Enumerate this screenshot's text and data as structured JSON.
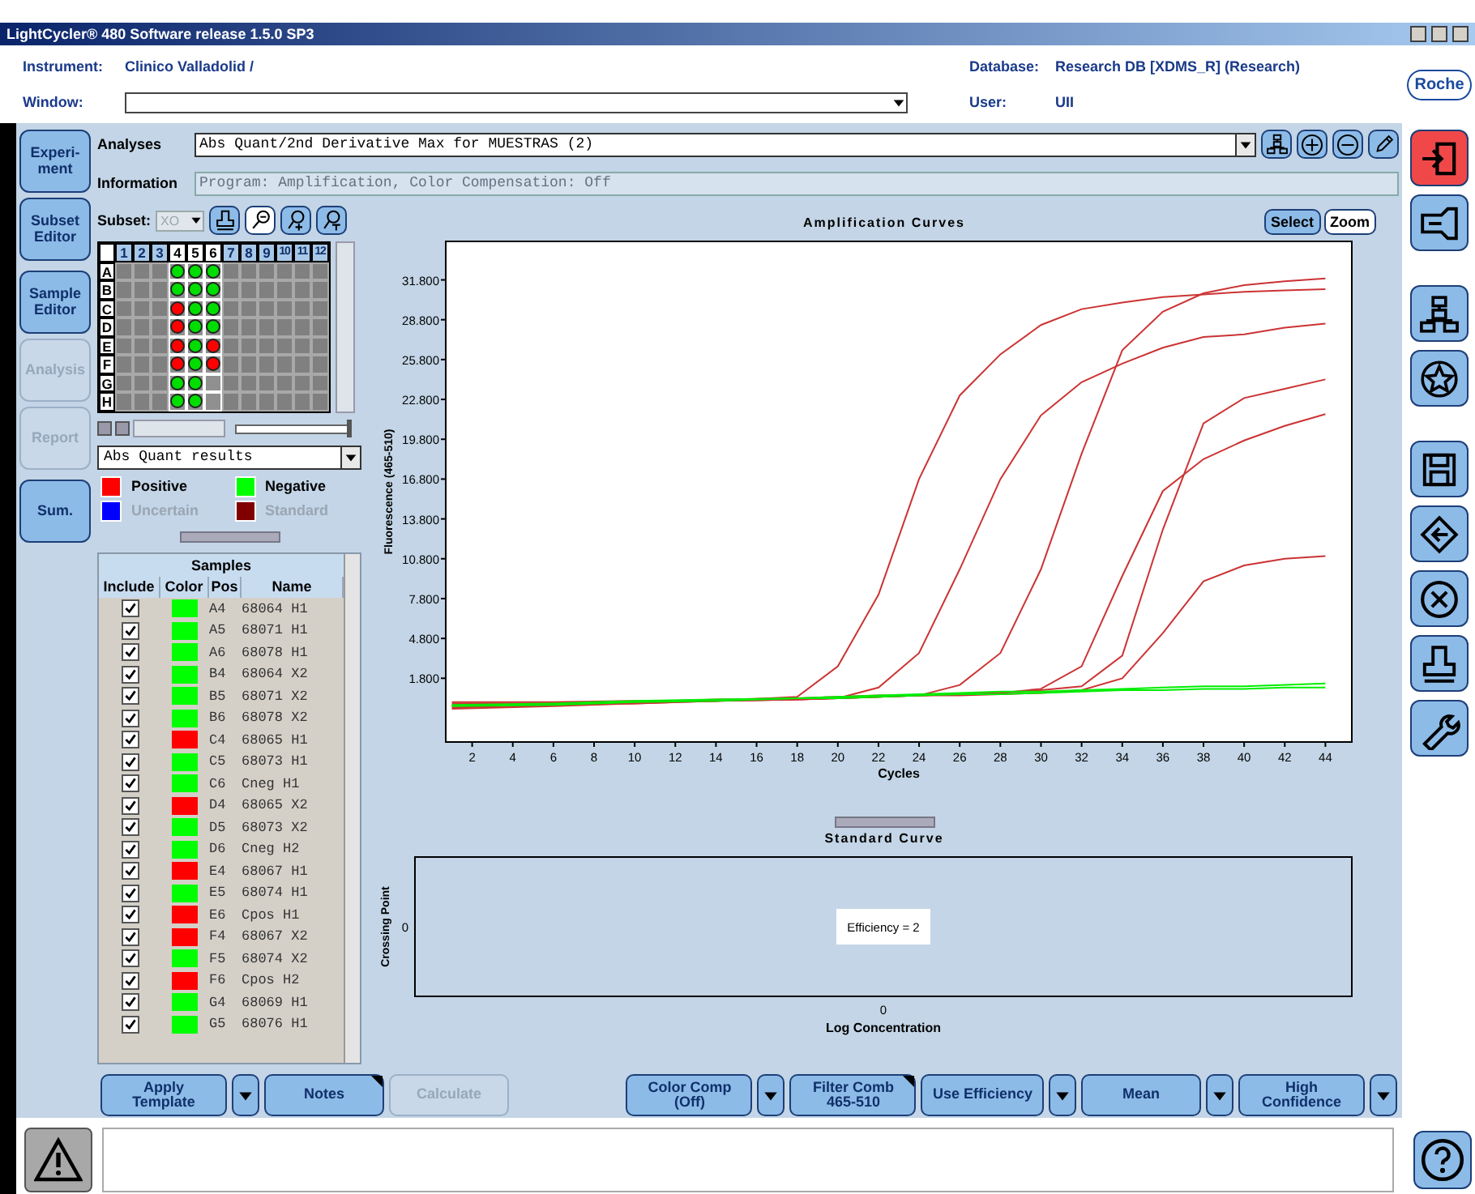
{
  "window": {
    "title": "LightCycler® 480 Software release 1.5.0 SP3"
  },
  "header": {
    "instrument_label": "Instrument:",
    "instrument": "Clinico Valladolid /",
    "window_label": "Window:",
    "database_label": "Database:",
    "database": "Research DB [XDMS_R] (Research)",
    "user_label": "User:",
    "user": "UII",
    "logo": "Roche"
  },
  "nav": [
    {
      "label": "Experi-ment",
      "disabled": false
    },
    {
      "label": "Subset Editor",
      "disabled": false
    },
    {
      "label": "Sample Editor",
      "disabled": false
    },
    {
      "label": "Analysis",
      "disabled": true
    },
    {
      "label": "Report",
      "disabled": true
    },
    {
      "label": "Sum.",
      "disabled": false
    }
  ],
  "analyses": {
    "label": "Analyses",
    "value": "Abs Quant/2nd Derivative Max for MUESTRAS (2)"
  },
  "information": {
    "label": "Information",
    "value": "Program: Amplification, Color Compensation: Off"
  },
  "subset": {
    "label": "Subset:",
    "value": "XO"
  },
  "plate": {
    "columns": [
      {
        "label": "1",
        "selected": false
      },
      {
        "label": "2",
        "selected": false
      },
      {
        "label": "3",
        "selected": false
      },
      {
        "label": "4",
        "selected": true
      },
      {
        "label": "5",
        "selected": true
      },
      {
        "label": "6",
        "selected": true
      },
      {
        "label": "7",
        "selected": false
      },
      {
        "label": "8",
        "selected": false
      },
      {
        "label": "9",
        "selected": false
      },
      {
        "label": "10",
        "selected": false
      },
      {
        "label": "11",
        "selected": false
      },
      {
        "label": "12",
        "selected": false
      }
    ],
    "rows": [
      {
        "label": "A",
        "wells": [
          {
            "filled": false
          },
          {
            "filled": false
          },
          {
            "filled": false
          },
          {
            "filled": true,
            "color": "#00dd00"
          },
          {
            "filled": true,
            "color": "#00dd00"
          },
          {
            "filled": true,
            "color": "#00dd00"
          },
          {
            "filled": false
          },
          {
            "filled": false
          },
          {
            "filled": false
          },
          {
            "filled": false
          },
          {
            "filled": false
          },
          {
            "filled": false
          }
        ]
      },
      {
        "label": "B",
        "wells": [
          {
            "filled": false
          },
          {
            "filled": false
          },
          {
            "filled": false
          },
          {
            "filled": true,
            "color": "#00dd00"
          },
          {
            "filled": true,
            "color": "#00dd00"
          },
          {
            "filled": true,
            "color": "#00dd00"
          },
          {
            "filled": false
          },
          {
            "filled": false
          },
          {
            "filled": false
          },
          {
            "filled": false
          },
          {
            "filled": false
          },
          {
            "filled": false
          }
        ]
      },
      {
        "label": "C",
        "wells": [
          {
            "filled": false
          },
          {
            "filled": false
          },
          {
            "filled": false
          },
          {
            "filled": true,
            "color": "#ff0000"
          },
          {
            "filled": true,
            "color": "#00dd00"
          },
          {
            "filled": true,
            "color": "#00dd00"
          },
          {
            "filled": false
          },
          {
            "filled": false
          },
          {
            "filled": false
          },
          {
            "filled": false
          },
          {
            "filled": false
          },
          {
            "filled": false
          }
        ]
      },
      {
        "label": "D",
        "wells": [
          {
            "filled": false
          },
          {
            "filled": false
          },
          {
            "filled": false
          },
          {
            "filled": true,
            "color": "#ff0000"
          },
          {
            "filled": true,
            "color": "#00dd00"
          },
          {
            "filled": true,
            "color": "#00dd00"
          },
          {
            "filled": false
          },
          {
            "filled": false
          },
          {
            "filled": false
          },
          {
            "filled": false
          },
          {
            "filled": false
          },
          {
            "filled": false
          }
        ]
      },
      {
        "label": "E",
        "wells": [
          {
            "filled": false
          },
          {
            "filled": false
          },
          {
            "filled": false
          },
          {
            "filled": true,
            "color": "#ff0000"
          },
          {
            "filled": true,
            "color": "#00dd00"
          },
          {
            "filled": true,
            "color": "#ff0000"
          },
          {
            "filled": false
          },
          {
            "filled": false
          },
          {
            "filled": false
          },
          {
            "filled": false
          },
          {
            "filled": false
          },
          {
            "filled": false
          }
        ]
      },
      {
        "label": "F",
        "wells": [
          {
            "filled": false
          },
          {
            "filled": false
          },
          {
            "filled": false
          },
          {
            "filled": true,
            "color": "#ff0000"
          },
          {
            "filled": true,
            "color": "#00dd00"
          },
          {
            "filled": true,
            "color": "#ff0000"
          },
          {
            "filled": false
          },
          {
            "filled": false
          },
          {
            "filled": false
          },
          {
            "filled": false
          },
          {
            "filled": false
          },
          {
            "filled": false
          }
        ]
      },
      {
        "label": "G",
        "wells": [
          {
            "filled": false
          },
          {
            "filled": false
          },
          {
            "filled": false
          },
          {
            "filled": true,
            "color": "#00dd00"
          },
          {
            "filled": true,
            "color": "#00dd00"
          },
          {
            "filled": false
          },
          {
            "filled": false
          },
          {
            "filled": false
          },
          {
            "filled": false
          },
          {
            "filled": false
          },
          {
            "filled": false
          },
          {
            "filled": false
          }
        ]
      },
      {
        "label": "H",
        "wells": [
          {
            "filled": false
          },
          {
            "filled": false
          },
          {
            "filled": false
          },
          {
            "filled": true,
            "color": "#00dd00"
          },
          {
            "filled": true,
            "color": "#00dd00"
          },
          {
            "filled": false
          },
          {
            "filled": false
          },
          {
            "filled": false
          },
          {
            "filled": false
          },
          {
            "filled": false
          },
          {
            "filled": false
          },
          {
            "filled": false
          }
        ]
      }
    ]
  },
  "plate_slider": {
    "level": 0.97
  },
  "results_dropdown": {
    "value": "Abs Quant results"
  },
  "legend": [
    {
      "label": "Positive",
      "color": "#ff0000",
      "disabled": false
    },
    {
      "label": "Negative",
      "color": "#00ff00",
      "disabled": false
    },
    {
      "label": "Uncertain",
      "color": "#0000ff",
      "disabled": true
    },
    {
      "label": "Standard",
      "color": "#800000",
      "disabled": true
    }
  ],
  "samples": {
    "title": "Samples",
    "columns": [
      "Include",
      "Color",
      "Pos",
      "Name"
    ],
    "rows": [
      {
        "included": true,
        "color": "#00ff00",
        "pos": "A4",
        "name": "68064 H1"
      },
      {
        "included": true,
        "color": "#00ff00",
        "pos": "A5",
        "name": "68071 H1"
      },
      {
        "included": true,
        "color": "#00ff00",
        "pos": "A6",
        "name": "68078 H1"
      },
      {
        "included": true,
        "color": "#00ff00",
        "pos": "B4",
        "name": "68064 X2"
      },
      {
        "included": true,
        "color": "#00ff00",
        "pos": "B5",
        "name": "68071 X2"
      },
      {
        "included": true,
        "color": "#00ff00",
        "pos": "B6",
        "name": "68078 X2"
      },
      {
        "included": true,
        "color": "#ff0000",
        "pos": "C4",
        "name": "68065 H1"
      },
      {
        "included": true,
        "color": "#00ff00",
        "pos": "C5",
        "name": "68073 H1"
      },
      {
        "included": true,
        "color": "#00ff00",
        "pos": "C6",
        "name": "Cneg H1"
      },
      {
        "included": true,
        "color": "#ff0000",
        "pos": "D4",
        "name": "68065 X2"
      },
      {
        "included": true,
        "color": "#00ff00",
        "pos": "D5",
        "name": "68073 X2"
      },
      {
        "included": true,
        "color": "#00ff00",
        "pos": "D6",
        "name": "Cneg H2"
      },
      {
        "included": true,
        "color": "#ff0000",
        "pos": "E4",
        "name": "68067 H1"
      },
      {
        "included": true,
        "color": "#00ff00",
        "pos": "E5",
        "name": "68074 H1"
      },
      {
        "included": true,
        "color": "#ff0000",
        "pos": "E6",
        "name": "Cpos H1"
      },
      {
        "included": true,
        "color": "#ff0000",
        "pos": "F4",
        "name": "68067 X2"
      },
      {
        "included": true,
        "color": "#00ff00",
        "pos": "F5",
        "name": "68074 X2"
      },
      {
        "included": true,
        "color": "#ff0000",
        "pos": "F6",
        "name": "Cpos H2"
      },
      {
        "included": true,
        "color": "#00ff00",
        "pos": "G4",
        "name": "68069 H1"
      },
      {
        "included": true,
        "color": "#00ff00",
        "pos": "G5",
        "name": "68076 H1"
      }
    ]
  },
  "amplification": {
    "buttons": [
      {
        "label": "Select",
        "selected": true
      },
      {
        "label": "Zoom",
        "selected": false
      }
    ],
    "chart_data": {
      "type": "line",
      "title": "Amplification Curves",
      "xlabel": "Cycles",
      "ylabel": "Fluorescence (465-510)",
      "x": [
        1,
        6,
        10,
        14,
        18,
        20,
        22,
        24,
        26,
        28,
        30,
        32,
        34,
        36,
        38,
        40,
        42,
        44
      ],
      "series": [
        {
          "color": "#cc3333",
          "values": [
            -300,
            -200,
            0,
            100,
            400,
            2700,
            8100,
            16800,
            23100,
            26200,
            28400,
            29600,
            30100,
            30500,
            30700,
            30900,
            31000,
            31100
          ]
        },
        {
          "color": "#cc3333",
          "values": [
            -200,
            -100,
            0,
            100,
            300,
            300,
            1100,
            3700,
            10000,
            16800,
            21600,
            24100,
            25500,
            26700,
            27500,
            27700,
            28200,
            28500
          ]
        },
        {
          "color": "#cc3333",
          "values": [
            -400,
            -200,
            -100,
            100,
            200,
            300,
            400,
            500,
            1300,
            3700,
            10000,
            18700,
            26500,
            29400,
            30800,
            31400,
            31700,
            31900
          ]
        },
        {
          "color": "#cc3333",
          "values": [
            -100,
            -100,
            0,
            200,
            300,
            400,
            500,
            500,
            600,
            700,
            900,
            1200,
            3500,
            13000,
            21000,
            22900,
            23600,
            24300
          ]
        },
        {
          "color": "#cc3333",
          "values": [
            -500,
            -300,
            -100,
            100,
            200,
            300,
            400,
            500,
            600,
            700,
            1000,
            2700,
            9500,
            15900,
            18300,
            19700,
            20800,
            21700
          ]
        },
        {
          "color": "#cc3333",
          "values": [
            0,
            0,
            100,
            100,
            200,
            300,
            400,
            500,
            500,
            600,
            700,
            900,
            1800,
            5200,
            9100,
            10300,
            10800,
            11000
          ]
        },
        {
          "color": "#00ee00",
          "values": [
            -300,
            -200,
            0,
            100,
            300,
            300,
            400,
            500,
            600,
            600,
            700,
            800,
            900,
            900,
            1000,
            1000,
            1100,
            1100
          ]
        },
        {
          "color": "#00ee00",
          "values": [
            -200,
            -100,
            100,
            200,
            300,
            400,
            500,
            600,
            700,
            800,
            800,
            900,
            1000,
            1100,
            1200,
            1200,
            1300,
            1400
          ]
        }
      ],
      "xlim": [
        0.7,
        45.3
      ],
      "ylim": [
        -3000,
        34700
      ],
      "xticks": [
        2,
        4,
        6,
        8,
        10,
        12,
        14,
        16,
        18,
        20,
        22,
        24,
        26,
        28,
        30,
        32,
        34,
        36,
        38,
        40,
        42,
        44
      ],
      "yticks": [
        {
          "value": 1800,
          "label": "1.800"
        },
        {
          "value": 4800,
          "label": "4.800"
        },
        {
          "value": 7800,
          "label": "7.800"
        },
        {
          "value": 10800,
          "label": "10.800"
        },
        {
          "value": 13800,
          "label": "13.800"
        },
        {
          "value": 16800,
          "label": "16.800"
        },
        {
          "value": 19800,
          "label": "19.800"
        },
        {
          "value": 22800,
          "label": "22.800"
        },
        {
          "value": 25800,
          "label": "25.800"
        },
        {
          "value": 28800,
          "label": "28.800"
        },
        {
          "value": 31800,
          "label": "31.800"
        }
      ]
    }
  },
  "standard_curve": {
    "title": "Standard Curve",
    "xlabel": "Log Concentration",
    "ylabel": "Crossing Point",
    "y_tick_label": "0",
    "x_tick_label": "0",
    "annotation": "Efficiency = 2"
  },
  "left_buttons": [
    {
      "label": "Apply Template",
      "dropdown": true,
      "disabled": false,
      "flag": false
    },
    {
      "label": "Notes",
      "dropdown": false,
      "disabled": false,
      "flag": true
    },
    {
      "label": "Calculate",
      "dropdown": false,
      "disabled": true,
      "flag": false
    }
  ],
  "right_buttons": [
    {
      "label": "Color Comp (Off)",
      "dropdown": true,
      "disabled": false,
      "flag": false
    },
    {
      "label": "Filter Comb 465-510",
      "dropdown": false,
      "disabled": false,
      "flag": true
    },
    {
      "label": "Use Efficiency",
      "dropdown": true,
      "disabled": false,
      "flag": false
    },
    {
      "label": "Mean",
      "dropdown": true,
      "disabled": false,
      "flag": false
    },
    {
      "label": "High Confidence",
      "dropdown": true,
      "disabled": false,
      "flag": false
    }
  ]
}
